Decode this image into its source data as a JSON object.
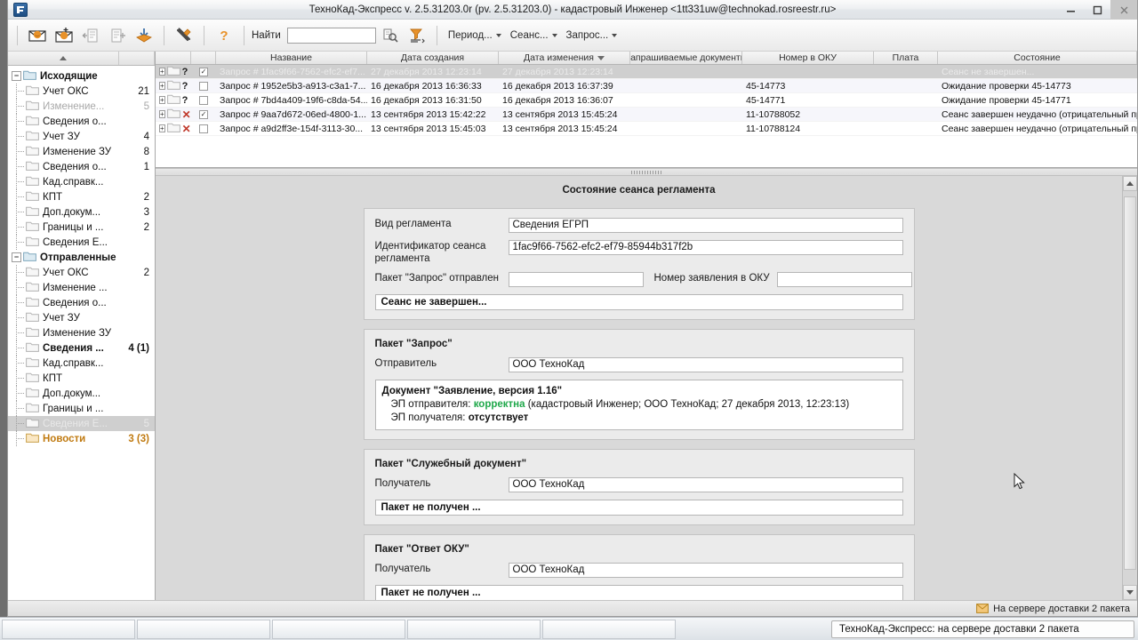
{
  "window": {
    "title": "ТехноКад-Экспресс v. 2.5.31203.0r (pv. 2.5.31203.0) - кадастровый Инженер <1tt331uw@technokad.rosreestr.ru>",
    "app_icon": "app-icon",
    "minimize": "minimize-icon",
    "maximize": "maximize-icon",
    "close": "close-icon"
  },
  "toolbar": {
    "buttons": [
      {
        "name": "receive-mail-button",
        "icon": "mail-receive-icon"
      },
      {
        "name": "new-mail-button",
        "icon": "mail-new-icon"
      },
      {
        "name": "reply-document-button",
        "icon": "document-reply-icon"
      },
      {
        "name": "add-document-button",
        "icon": "document-add-icon"
      },
      {
        "name": "sync-button",
        "icon": "sync-arrows-icon"
      },
      {
        "name": "settings-button",
        "icon": "tools-icon"
      },
      {
        "name": "help-button",
        "icon": "question-mark-icon"
      }
    ],
    "find_label": "Найти",
    "find_value": "",
    "find_placeholder": "",
    "find_button": "find-magnifier-icon",
    "filter_button": "filter-funnel-icon",
    "menus": [
      {
        "name": "menu-period",
        "label": "Период..."
      },
      {
        "name": "menu-session",
        "label": "Сеанс..."
      },
      {
        "name": "menu-request",
        "label": "Запрос..."
      }
    ]
  },
  "sidebar": {
    "header_sort": "sort-ascending-icon",
    "groups": [
      {
        "label": "Исходящие",
        "count": "",
        "items": [
          {
            "label": "Учет ОКС",
            "count": "21",
            "state": "normal"
          },
          {
            "label": "Изменение...",
            "count": "5",
            "state": "dim"
          },
          {
            "label": "Сведения о...",
            "count": "",
            "state": "normal"
          },
          {
            "label": "Учет ЗУ",
            "count": "4",
            "state": "normal"
          },
          {
            "label": "Изменение ЗУ",
            "count": "8",
            "state": "normal"
          },
          {
            "label": "Сведения о...",
            "count": "1",
            "state": "normal"
          },
          {
            "label": "Кад.справк...",
            "count": "",
            "state": "normal"
          },
          {
            "label": "КПТ",
            "count": "2",
            "state": "normal"
          },
          {
            "label": "Доп.докум...",
            "count": "3",
            "state": "normal"
          },
          {
            "label": "Границы и ...",
            "count": "2",
            "state": "normal"
          },
          {
            "label": "Сведения Е...",
            "count": "",
            "state": "normal"
          }
        ]
      },
      {
        "label": "Отправленные",
        "count": "",
        "items": [
          {
            "label": "Учет ОКС",
            "count": "2",
            "state": "normal"
          },
          {
            "label": "Изменение ...",
            "count": "",
            "state": "normal"
          },
          {
            "label": "Сведения о...",
            "count": "",
            "state": "normal"
          },
          {
            "label": "Учет ЗУ",
            "count": "",
            "state": "normal"
          },
          {
            "label": "Изменение ЗУ",
            "count": "",
            "state": "normal"
          },
          {
            "label": "Сведения ...",
            "count": "4 (1)",
            "state": "bold"
          },
          {
            "label": "Кад.справк...",
            "count": "",
            "state": "normal"
          },
          {
            "label": "КПТ",
            "count": "",
            "state": "normal"
          },
          {
            "label": "Доп.докум...",
            "count": "",
            "state": "normal"
          },
          {
            "label": "Границы и ...",
            "count": "",
            "state": "normal"
          },
          {
            "label": "Сведения Е...",
            "count": "5",
            "state": "selected"
          }
        ]
      }
    ],
    "news": {
      "label": "Новости",
      "count": "3 (3)"
    }
  },
  "grid": {
    "columns": [
      {
        "name": "column-tree",
        "label": ""
      },
      {
        "name": "column-check",
        "label": ""
      },
      {
        "name": "column-name",
        "label": "Название"
      },
      {
        "name": "column-created",
        "label": "Дата создания"
      },
      {
        "name": "column-modified",
        "label": "Дата изменения",
        "sorted": "desc"
      },
      {
        "name": "column-requested-docs",
        "label": "Запрашиваемые документы"
      },
      {
        "name": "column-oku-number",
        "label": "Номер в ОКУ"
      },
      {
        "name": "column-payment",
        "label": "Плата"
      },
      {
        "name": "column-state",
        "label": "Состояние"
      }
    ],
    "rows": [
      {
        "status_icon": "question-mark-icon",
        "checked": true,
        "name": "Запрос # 1fac9f66-7562-efc2-ef7...",
        "created": "27 декабря 2013 12:23:14",
        "modified": "27 декабря 2013 12:23:14",
        "requested_docs": "",
        "oku_number": "",
        "payment": "",
        "state": "Сеанс не завершен...",
        "selected": true
      },
      {
        "status_icon": "question-mark-icon",
        "checked": false,
        "name": "Запрос # 1952e5b3-a913-c3a1-7...",
        "created": "16 декабря 2013 16:36:33",
        "modified": "16 декабря 2013 16:37:39",
        "requested_docs": "",
        "oku_number": "45-14773",
        "payment": "",
        "state": "Ожидание проверки   45-14773",
        "selected": false
      },
      {
        "status_icon": "question-mark-icon",
        "checked": false,
        "name": "Запрос # 7bd4a409-19f6-c8da-54...",
        "created": "16 декабря 2013 16:31:50",
        "modified": "16 декабря 2013 16:36:07",
        "requested_docs": "",
        "oku_number": "45-14771",
        "payment": "",
        "state": "Ожидание проверки   45-14771",
        "selected": false
      },
      {
        "status_icon": "red-x-icon",
        "checked": true,
        "name": "Запрос # 9aa7d672-06ed-4800-1...",
        "created": "13 сентября 2013 15:42:22",
        "modified": "13 сентября 2013 15:45:24",
        "requested_docs": "",
        "oku_number": "11-10788052",
        "payment": "",
        "state": "Сеанс завершен неудачно (отрицательный пр...",
        "selected": false
      },
      {
        "status_icon": "red-x-icon",
        "checked": false,
        "name": "Запрос # a9d2ff3e-154f-3113-30...",
        "created": "13 сентября 2013 15:45:03",
        "modified": "13 сентября 2013 15:45:24",
        "requested_docs": "",
        "oku_number": "11-10788124",
        "payment": "",
        "state": "Сеанс завершен неудачно (отрицательный пр...",
        "selected": false
      }
    ]
  },
  "detail": {
    "title": "Состояние сеанса регламента",
    "section_main": {
      "regulation_type_label": "Вид регламента",
      "regulation_type_value": "Сведения ЕГРП",
      "session_id_label": "Идентификатор сеанса регламента",
      "session_id_value": "1fac9f66-7562-efc2-ef79-85944b317f2b",
      "request_sent_label": "Пакет \"Запрос\" отправлен",
      "request_sent_value": "",
      "oku_app_number_label": "Номер заявления в ОКУ",
      "oku_app_number_value": "",
      "status": "Сеанс не завершен..."
    },
    "section_request": {
      "title": "Пакет \"Запрос\"",
      "sender_label": "Отправитель",
      "sender_value": "ООО ТехноКад",
      "doc_title": "Документ \"Заявление, версия 1.16\"",
      "sender_sig_label": "ЭП отправителя:",
      "sender_sig_status": "корректна",
      "sender_sig_details": "(кадастровый Инженер; ООО ТехноКад; 27 декабря 2013, 12:23:13)",
      "receiver_sig_label": "ЭП получателя:",
      "receiver_sig_status": "отсутствует"
    },
    "section_service": {
      "title": "Пакет \"Служебный документ\"",
      "receiver_label": "Получатель",
      "receiver_value": "ООО ТехноКад",
      "status": "Пакет не получен ..."
    },
    "section_answer": {
      "title": "Пакет \"Ответ ОКУ\"",
      "receiver_label": "Получатель",
      "receiver_value": "ООО ТехноКад",
      "status": "Пакет не получен ..."
    },
    "scroll_up": "scroll-up-arrow-icon",
    "scroll_down": "scroll-down-arrow-icon"
  },
  "statusbar": {
    "icon": "envelope-icon",
    "text": "На сервере доставки 2 пакета"
  },
  "notification": {
    "text": "ТехноКад-Экспресс: на сервере доставки 2 пакета"
  },
  "colors": {
    "accent_orange": "#e8922a",
    "ok_green": "#1fa84a",
    "error_red": "#c0392b",
    "news_orange": "#c07a10",
    "selection_gray": "#cfcfcf"
  }
}
